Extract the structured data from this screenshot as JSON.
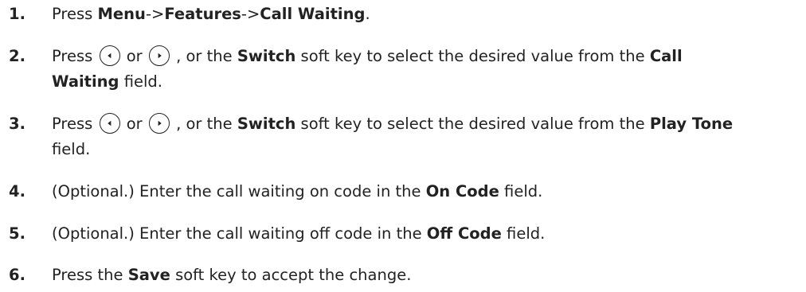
{
  "steps": [
    {
      "number": "1.",
      "press": "Press ",
      "menu": "Menu",
      "arrow1": "->",
      "features": "Features",
      "arrow2": "->",
      "call_waiting": "Call Waiting",
      "end": "."
    },
    {
      "number": "2.",
      "press": "Press ",
      "or": " or ",
      "middle": " , or the ",
      "switch": "Switch",
      "after_switch": " soft key to select the desired value from the ",
      "field_part1": "Call",
      "field_part2": "Waiting",
      "end": " field.",
      "left_icon": "left-arrow-key-icon",
      "right_icon": "right-arrow-key-icon"
    },
    {
      "number": "3.",
      "press": "Press ",
      "or": " or ",
      "middle": " , or the ",
      "switch": "Switch",
      "after_switch": " soft key to select the desired value from the ",
      "field": "Play Tone",
      "end": "field.",
      "left_icon": "left-arrow-key-icon",
      "right_icon": "right-arrow-key-icon"
    },
    {
      "number": "4.",
      "before": "(Optional.) Enter the call waiting on code in the ",
      "field": "On Code",
      "end": " field."
    },
    {
      "number": "5.",
      "before": "(Optional.) Enter the call waiting off code in the ",
      "field": "Off Code",
      "end": " field."
    },
    {
      "number": "6.",
      "before": "Press the ",
      "key": "Save",
      "end": " soft key to accept the change."
    }
  ]
}
